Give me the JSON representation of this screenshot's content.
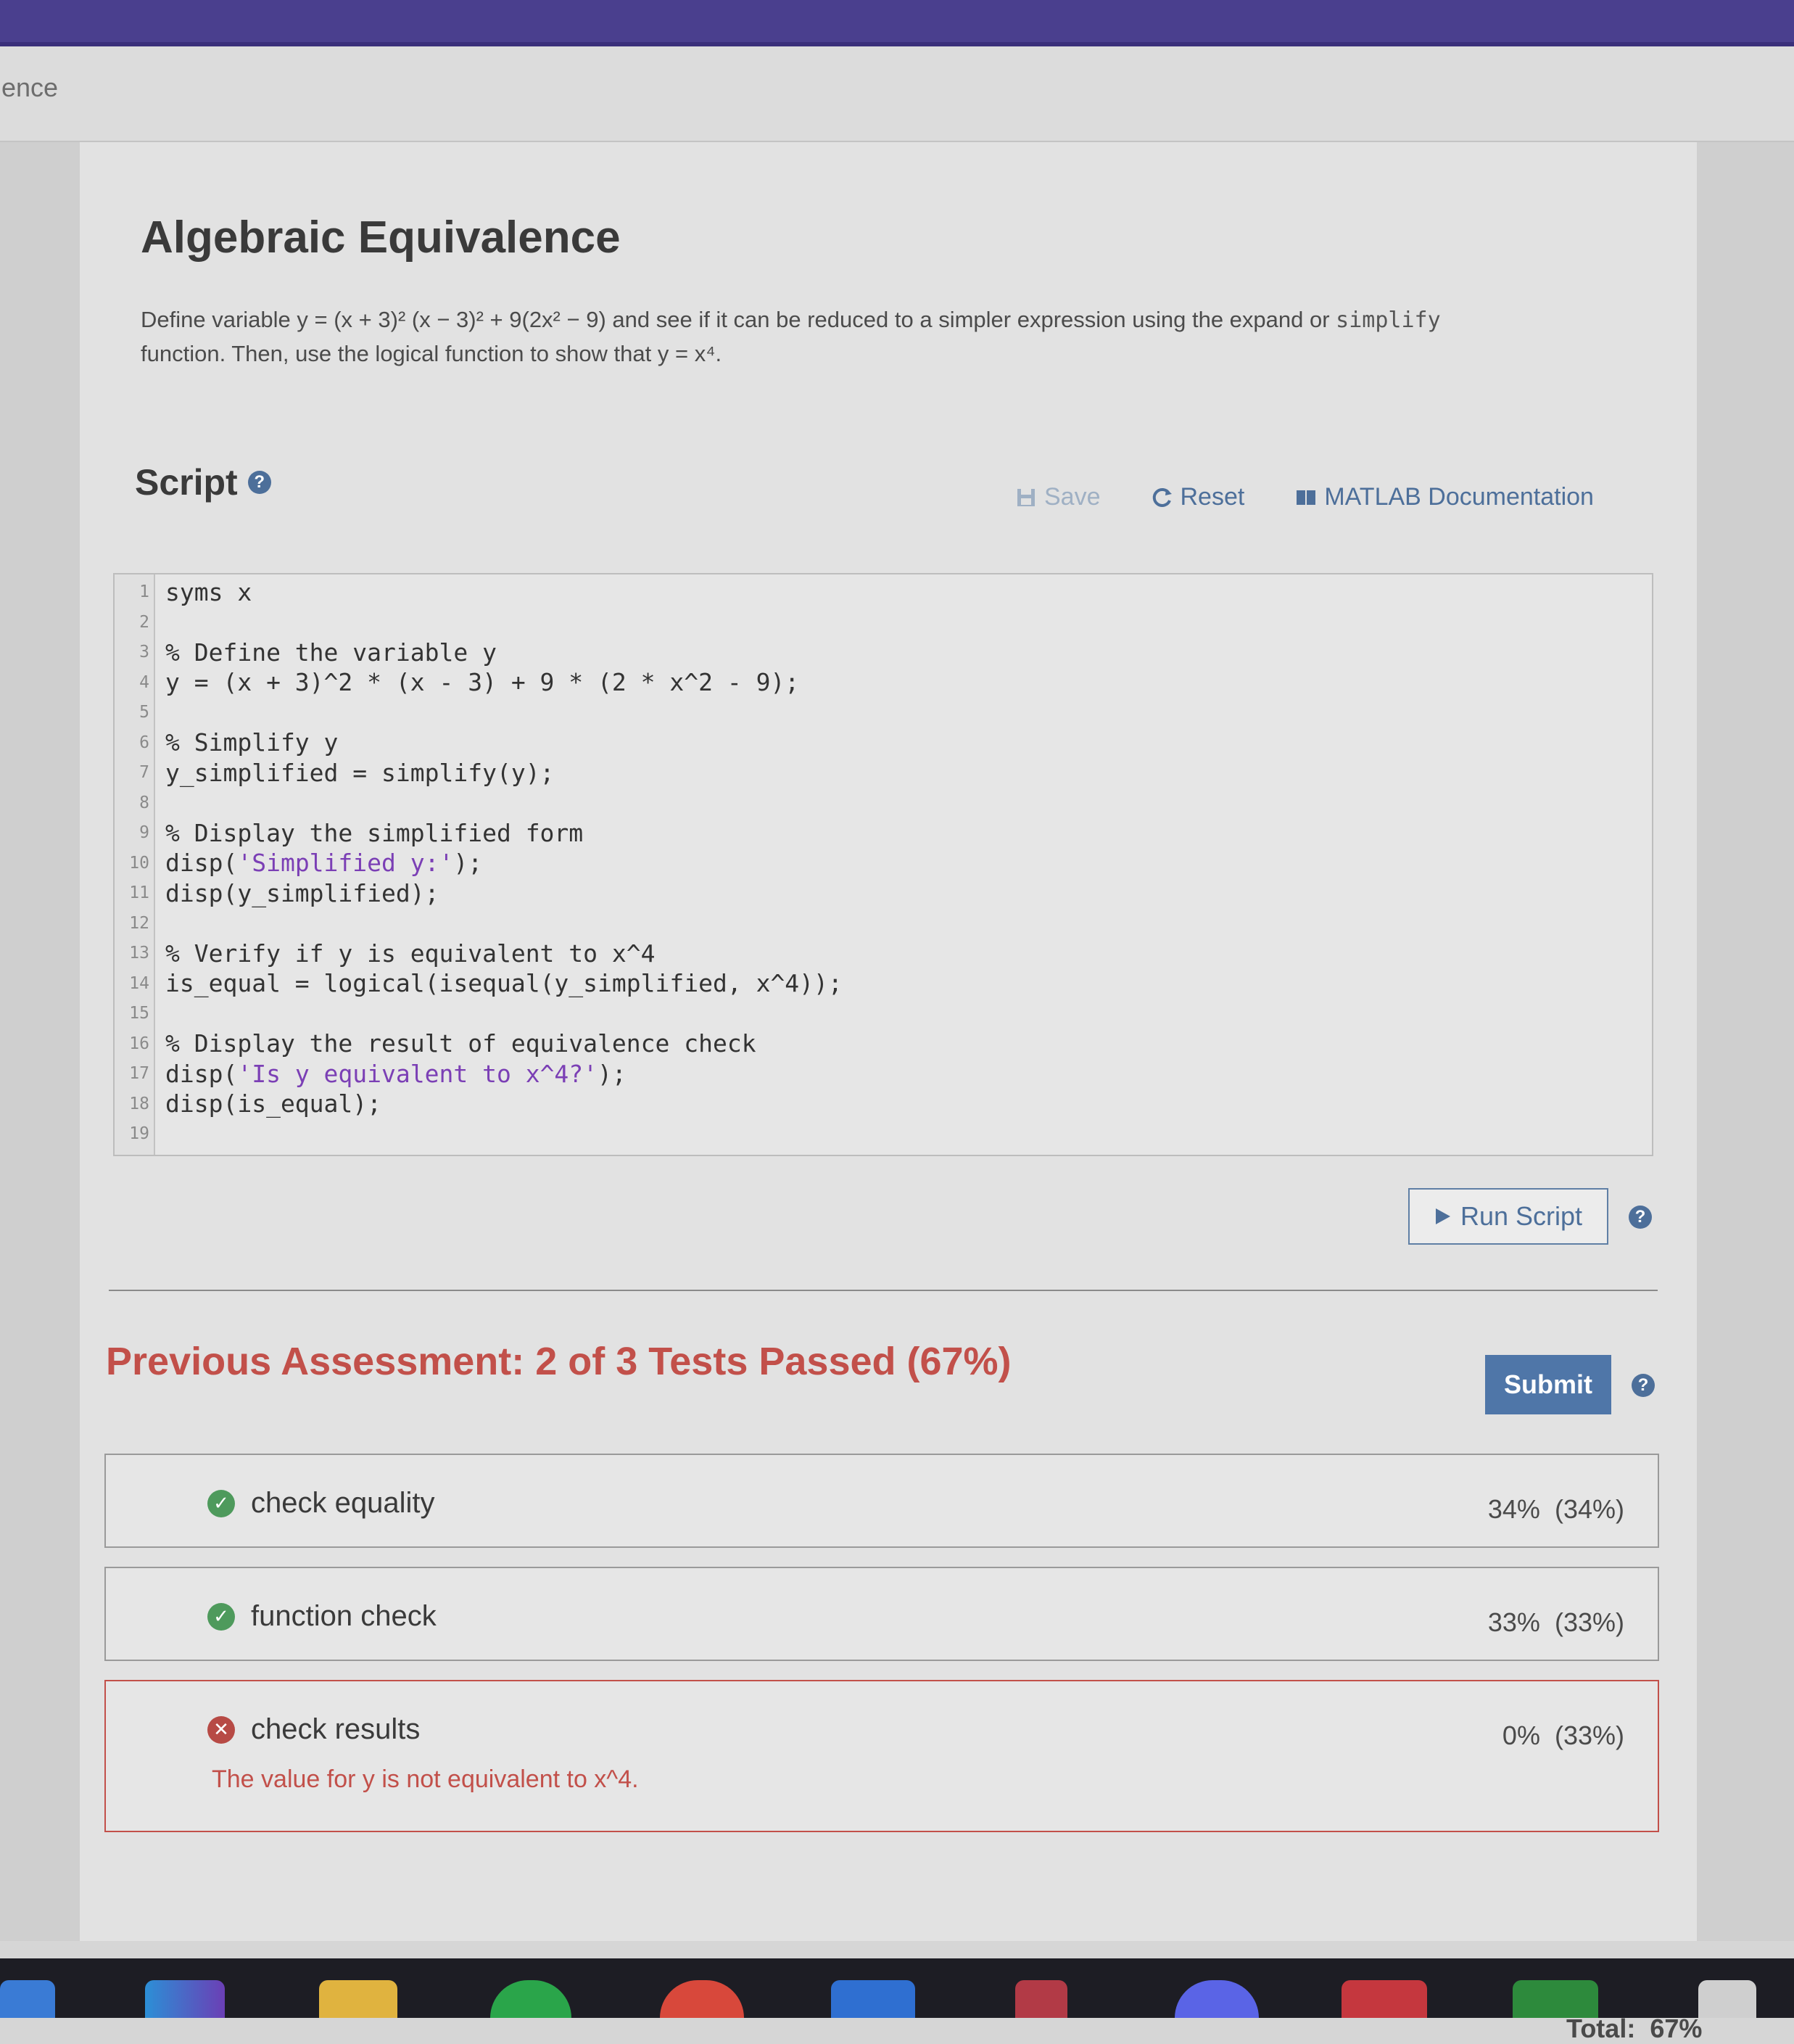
{
  "browser": {
    "tab_title": "ence"
  },
  "page": {
    "title": "Algebraic Equivalence",
    "description": {
      "before_eq": "Define variable ",
      "equation": "y = (x + 3)² (x − 3)² + 9(2x² − 9)",
      "middle": " and see if it can be reduced to a simpler expression using the expand or ",
      "code_word": "simplify",
      "line2_pre": "function.  Then, use the logical function to show that ",
      "target": "y = x⁴",
      "end": "."
    }
  },
  "script_section": {
    "heading": "Script",
    "help_glyph": "?",
    "toolbar": {
      "save_label": "Save",
      "reset_label": "Reset",
      "docs_label": "MATLAB Documentation"
    },
    "code_lines": [
      {
        "n": "1",
        "text": "syms x"
      },
      {
        "n": "2",
        "text": ""
      },
      {
        "n": "3",
        "text": "% Define the variable y"
      },
      {
        "n": "4",
        "text": "y = (x + 3)^2 * (x - 3) + 9 * (2 * x^2 - 9);"
      },
      {
        "n": "5",
        "text": ""
      },
      {
        "n": "6",
        "text": "% Simplify y"
      },
      {
        "n": "7",
        "text": "y_simplified = simplify(y);"
      },
      {
        "n": "8",
        "text": ""
      },
      {
        "n": "9",
        "text": "% Display the simplified form"
      },
      {
        "n": "10",
        "text": "disp('Simplified y:');"
      },
      {
        "n": "11",
        "text": "disp(y_simplified);"
      },
      {
        "n": "12",
        "text": ""
      },
      {
        "n": "13",
        "text": "% Verify if y is equivalent to x^4"
      },
      {
        "n": "14",
        "text": "is_equal = logical(isequal(y_simplified, x^4));"
      },
      {
        "n": "15",
        "text": ""
      },
      {
        "n": "16",
        "text": "% Display the result of equivalence check"
      },
      {
        "n": "17",
        "text": "disp('Is y equivalent to x^4?');"
      },
      {
        "n": "18",
        "text": "disp(is_equal);"
      },
      {
        "n": "19",
        "text": ""
      }
    ],
    "run_label": "Run Script"
  },
  "assessment": {
    "title": "Previous Assessment: 2 of 3 Tests Passed (67%)",
    "submit_label": "Submit",
    "tests": [
      {
        "name": "check equality",
        "score": "34%",
        "weight": "(34%)",
        "status": "pass",
        "message": ""
      },
      {
        "name": "function check",
        "score": "33%",
        "weight": "(33%)",
        "status": "pass",
        "message": ""
      },
      {
        "name": "check results",
        "score": "0%",
        "weight": "(33%)",
        "status": "fail",
        "message": "The value for y is not equivalent to x^4."
      }
    ],
    "total_label": "Total:",
    "total_value": "67%"
  },
  "colors": {
    "accent": "#4d6f9a",
    "fail": "#c2504a",
    "pass": "#4e9a5c",
    "submit": "#4f76a8",
    "topbar": "#4a3f8e"
  },
  "taskbar_icons": [
    "windows-icon",
    "edge-icon",
    "file-explorer-icon",
    "spotify-icon",
    "chrome-icon",
    "app-icon",
    "pin-icon",
    "discord-icon",
    "app-red-icon",
    "app-green-icon",
    "settings-icon"
  ]
}
